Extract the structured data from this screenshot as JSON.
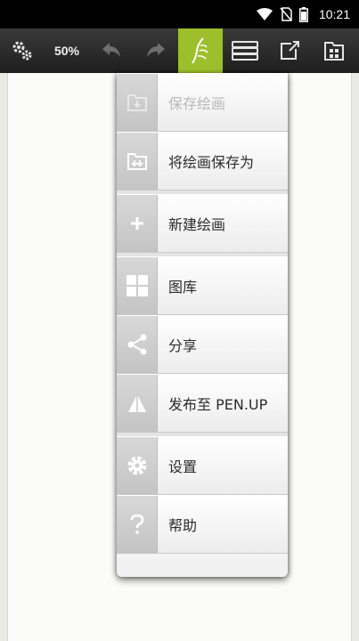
{
  "status_bar": {
    "time": "10:21",
    "icons": [
      "wifi-icon",
      "no-sim-icon",
      "battery-icon"
    ]
  },
  "toolbar": {
    "zoom_label": "50%",
    "buttons": [
      "settings-icon",
      "undo-icon",
      "redo-icon",
      "pen-icon",
      "layers-icon",
      "export-icon",
      "menu-panel-icon"
    ],
    "active_color": "#9cbf2b"
  },
  "menu": {
    "items": [
      {
        "label": "保存绘画",
        "icon": "save-icon",
        "enabled": false
      },
      {
        "label": "将绘画保存为",
        "icon": "save-as-icon",
        "enabled": true
      },
      {
        "label": "新建绘画",
        "icon": "plus-icon",
        "enabled": true
      },
      {
        "label": "图库",
        "icon": "gallery-grid-icon",
        "enabled": true
      },
      {
        "label": "分享",
        "icon": "share-icon",
        "enabled": true
      },
      {
        "label": "发布至 PEN.UP",
        "icon": "penup-icon",
        "enabled": true
      },
      {
        "label": "设置",
        "icon": "gear-icon",
        "enabled": true
      },
      {
        "label": "帮助",
        "icon": "help-icon",
        "enabled": true
      }
    ]
  }
}
